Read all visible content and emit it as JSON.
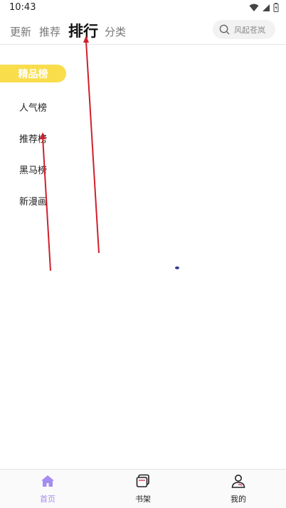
{
  "status_bar": {
    "time": "10:43"
  },
  "top_tabs": [
    {
      "label": "更新"
    },
    {
      "label": "推荐"
    },
    {
      "label": "排行"
    },
    {
      "label": "分类"
    }
  ],
  "search": {
    "placeholder": "风起苍岚"
  },
  "ranking": [
    {
      "label": "精品榜"
    },
    {
      "label": "人气榜"
    },
    {
      "label": "推荐榜"
    },
    {
      "label": "黑马榜"
    },
    {
      "label": "新漫画"
    }
  ],
  "bottom_nav": [
    {
      "label": "首页",
      "icon": "home-icon"
    },
    {
      "label": "书架",
      "icon": "bookshelf-icon"
    },
    {
      "label": "我的",
      "icon": "profile-icon"
    }
  ],
  "colors": {
    "accent_yellow": "#f9dd4b",
    "nav_active": "#a58cf0",
    "annotation_red": "#d01f2b"
  }
}
